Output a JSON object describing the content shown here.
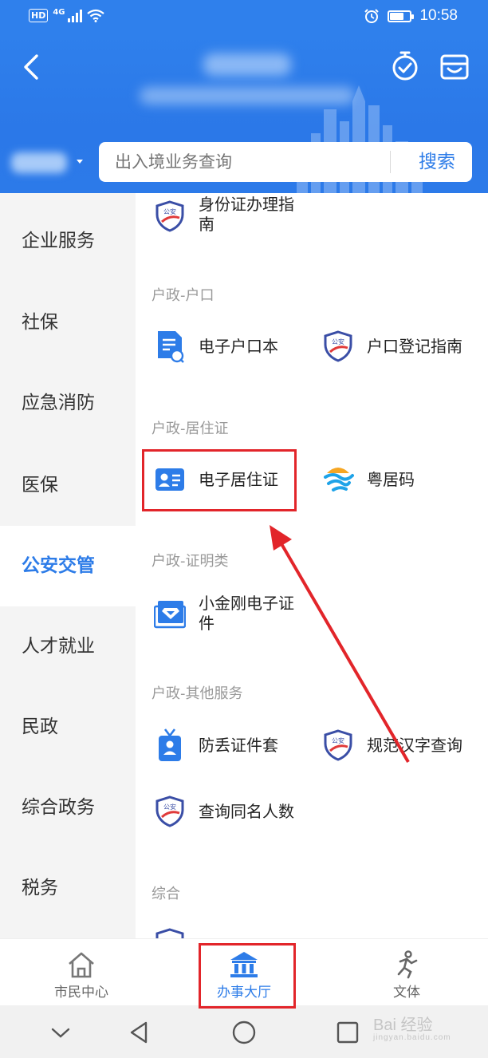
{
  "status_bar": {
    "hd_label": "HD",
    "network": "4G",
    "time": "10:58"
  },
  "header": {
    "search_placeholder": "出入境业务查询",
    "search_button": "搜索"
  },
  "left_nav": {
    "items": [
      {
        "label": "企业服务"
      },
      {
        "label": "社保"
      },
      {
        "label": "应急消防"
      },
      {
        "label": "医保"
      },
      {
        "label": "公安交管",
        "active": true
      },
      {
        "label": "人才就业"
      },
      {
        "label": "民政"
      },
      {
        "label": "综合政务"
      },
      {
        "label": "税务"
      }
    ]
  },
  "content": {
    "top_item": {
      "label": "身份证办理指南",
      "icon": "police-badge-icon"
    },
    "sections": [
      {
        "title": "户政-户口",
        "items": [
          {
            "label": "电子户口本",
            "icon": "document-search-icon"
          },
          {
            "label": "户口登记指南",
            "icon": "police-badge-icon"
          }
        ]
      },
      {
        "title": "户政-居住证",
        "items": [
          {
            "label": "电子居住证",
            "icon": "id-card-icon",
            "highlighted": true
          },
          {
            "label": "粤居码",
            "icon": "wave-logo-icon"
          }
        ]
      },
      {
        "title": "户政-证明类",
        "items": [
          {
            "label": "小金刚电子证件",
            "icon": "diamond-certificate-icon"
          }
        ]
      },
      {
        "title": "户政-其他服务",
        "items": [
          {
            "label": "防丢证件套",
            "icon": "badge-holder-icon"
          },
          {
            "label": "规范汉字查询",
            "icon": "police-badge-icon"
          },
          {
            "label": "查询同名人数",
            "icon": "police-badge-icon"
          }
        ]
      },
      {
        "title": "综合",
        "items": []
      }
    ],
    "badge_text": "公安"
  },
  "tab_bar": {
    "tabs": [
      {
        "label": "市民中心",
        "icon": "home-icon"
      },
      {
        "label": "办事大厅",
        "icon": "government-building-icon",
        "active": true
      },
      {
        "label": "文体",
        "icon": "running-person-icon"
      }
    ]
  },
  "watermark": {
    "text": "Bai 经验",
    "sub": "jingyan.baidu.com"
  },
  "colors": {
    "primary": "#2d7ce8",
    "header_bg": "#2f80ec",
    "highlight": "#e2252a",
    "nav_bg": "#f4f4f4"
  }
}
